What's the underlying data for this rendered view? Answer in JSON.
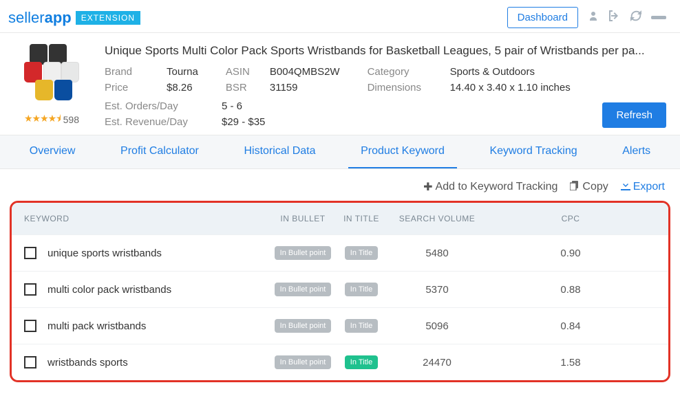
{
  "brand": {
    "left": "seller",
    "right": "app",
    "badge": "EXTENSION"
  },
  "topbar": {
    "dashboard": "Dashboard"
  },
  "product": {
    "title": "Unique Sports Multi Color Pack Sports Wristbands for Basketball Leagues, 5 pair of Wristbands per pa...",
    "reviews": "598",
    "labels": {
      "brand": "Brand",
      "price": "Price",
      "asin": "ASIN",
      "bsr": "BSR",
      "category": "Category",
      "dimensions": "Dimensions",
      "orders": "Est. Orders/Day",
      "revenue": "Est. Revenue/Day"
    },
    "brand": "Tourna",
    "price": "$8.26",
    "asin": "B004QMBS2W",
    "bsr": "31159",
    "category": "Sports & Outdoors",
    "dimensions": "14.40 x 3.40 x 1.10 inches",
    "orders": "5 - 6",
    "revenue": "$29 - $35",
    "refresh": "Refresh"
  },
  "tabs": [
    "Overview",
    "Profit Calculator",
    "Historical Data",
    "Product Keyword",
    "Keyword Tracking",
    "Alerts"
  ],
  "actions": {
    "add": "Add to Keyword Tracking",
    "copy": "Copy",
    "export": "Export"
  },
  "table": {
    "headers": {
      "keyword": "KEYWORD",
      "inBullet": "IN BULLET",
      "inTitle": "IN TITLE",
      "volume": "SEARCH VOLUME",
      "cpc": "CPC"
    },
    "bulletPill": "In Bullet point",
    "titlePill": "In Title",
    "rows": [
      {
        "keyword": "unique sports wristbands",
        "volume": "5480",
        "cpc": "0.90",
        "titleGreen": false
      },
      {
        "keyword": "multi color pack wristbands",
        "volume": "5370",
        "cpc": "0.88",
        "titleGreen": false
      },
      {
        "keyword": "multi pack wristbands",
        "volume": "5096",
        "cpc": "0.84",
        "titleGreen": false
      },
      {
        "keyword": "wristbands sports",
        "volume": "24470",
        "cpc": "1.58",
        "titleGreen": true
      }
    ]
  }
}
